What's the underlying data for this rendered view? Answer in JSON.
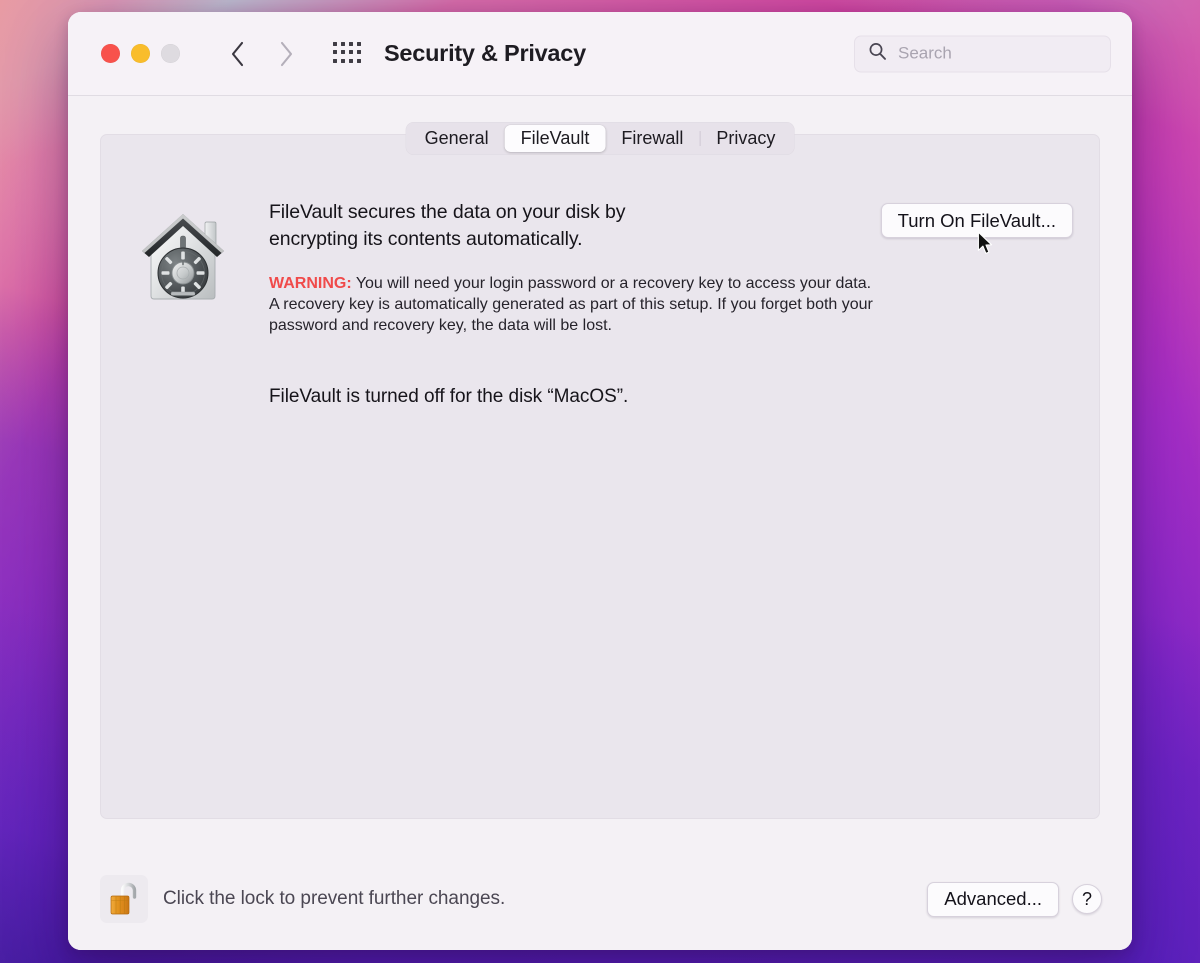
{
  "window": {
    "title": "Security & Privacy",
    "traffic_lights": {
      "close": "close-button",
      "minimize": "minimize-button",
      "zoom": "zoom-button"
    },
    "nav": {
      "back": "back-button",
      "forward": "forward-button",
      "show_all": "show-all-grid-button"
    }
  },
  "search": {
    "placeholder": "Search",
    "value": "",
    "icon": "search-icon"
  },
  "tabs": [
    {
      "label": "General",
      "active": false
    },
    {
      "label": "FileVault",
      "active": true
    },
    {
      "label": "Firewall",
      "active": false
    },
    {
      "label": "Privacy",
      "active": false
    }
  ],
  "filevault": {
    "icon": "filevault-house-safe-icon",
    "headline": "FileVault secures the data on your disk by encrypting its contents automatically.",
    "warning_label": "WARNING:",
    "warning_body": " You will need your login password or a recovery key to access your data. A recovery key is automatically generated as part of this setup. If you forget both your password and recovery key, the data will be lost.",
    "status": "FileVault is turned off for the disk “MacOS”.",
    "turn_on_button": "Turn On FileVault..."
  },
  "footer": {
    "lock_icon": "unlocked-padlock-icon",
    "lock_message": "Click the lock to prevent further changes.",
    "advanced_button": "Advanced...",
    "help_button": "?"
  },
  "cursor": {
    "icon": "mouse-pointer-arrow"
  },
  "colors": {
    "accent_warning": "#f04a4a",
    "window_background": "#f4f1f5",
    "panel_background": "#eae6ed",
    "tab_track": "#e7e2ea",
    "tab_active": "#fdfcfe",
    "traffic_close": "#f8524c",
    "traffic_minimize": "#f9bd2b",
    "traffic_zoom": "#dedbe0",
    "lock_gold": "#e59a28"
  }
}
